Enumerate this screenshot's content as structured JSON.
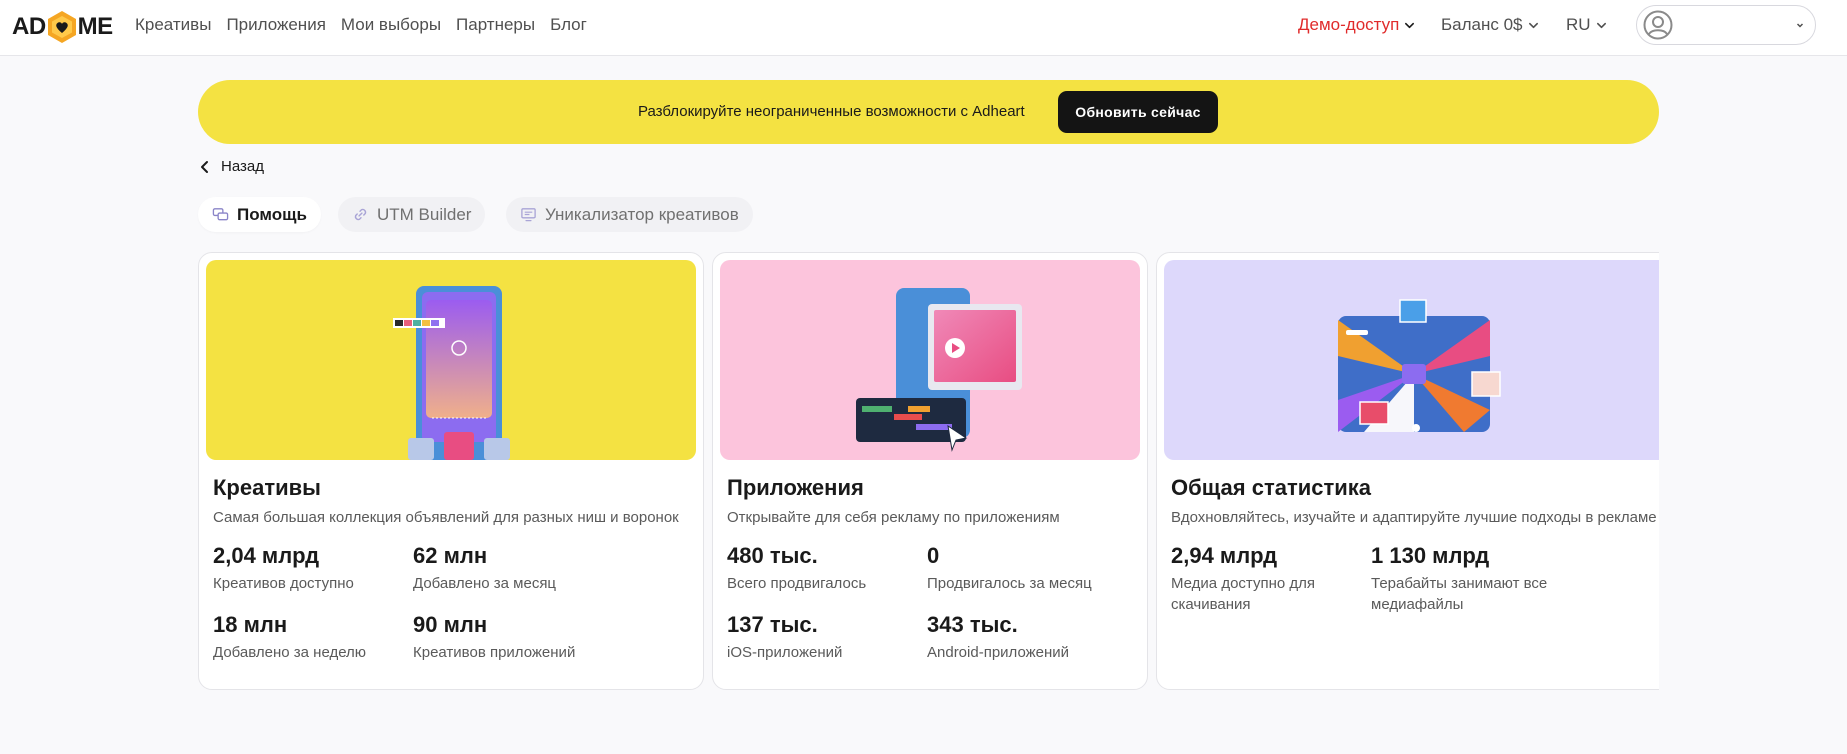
{
  "brand": {
    "logo_left": "AD",
    "logo_right": "ME"
  },
  "nav": [
    {
      "label": "Креативы"
    },
    {
      "label": "Приложения"
    },
    {
      "label": "Мои выборы"
    },
    {
      "label": "Партнеры"
    },
    {
      "label": "Блог"
    }
  ],
  "header": {
    "demo_label": "Демо-доступ",
    "balance_label": "Баланс 0$",
    "lang_label": "RU",
    "demo_color": "#e02b2b"
  },
  "banner": {
    "text": "Разблокируйте неограниченные возможности с Adheart",
    "button_label": "Обновить сейчас",
    "color": "#f4e242"
  },
  "back_label": "Назад",
  "tabs": [
    {
      "label": "Помощь",
      "icon": "chat-icon",
      "active": true
    },
    {
      "label": "UTM Builder",
      "icon": "link-icon",
      "active": false
    },
    {
      "label": "Уникализатор креативов",
      "icon": "monitor-icon",
      "active": false
    }
  ],
  "cards": [
    {
      "title": "Креативы",
      "description": "Самая большая коллекция объявлений для разных ниш и воронок",
      "bg_color": "#f4e242",
      "stats": [
        {
          "value": "2,04 млрд",
          "label": "Креативов доступно"
        },
        {
          "value": "62 млн",
          "label": "Добавлено за месяц"
        },
        {
          "value": "18 млн",
          "label": "Добавлено за неделю"
        },
        {
          "value": "90 млн",
          "label": "Креативов приложений"
        }
      ]
    },
    {
      "title": "Приложения",
      "description": "Открывайте для себя рекламу по приложениям",
      "bg_color": "#fcc4dc",
      "stats": [
        {
          "value": "480 тыс.",
          "label": "Всего продвигалось"
        },
        {
          "value": "0",
          "label": "Продвигалось за месяц"
        },
        {
          "value": "137 тыс.",
          "label": "iOS-приложений"
        },
        {
          "value": "343 тыс.",
          "label": "Android-приложений"
        }
      ]
    },
    {
      "title": "Общая статистика",
      "description": "Вдохновляйтесь, изучайте и адаптируйте лучшие подходы в рекламе",
      "bg_color": "#ddd8fb",
      "stats": [
        {
          "value": "2,94 млрд",
          "label": "Медиа доступно для скачивания"
        },
        {
          "value": "1 130 млрд",
          "label": "Терабайты занимают все медиафайлы"
        }
      ]
    }
  ]
}
